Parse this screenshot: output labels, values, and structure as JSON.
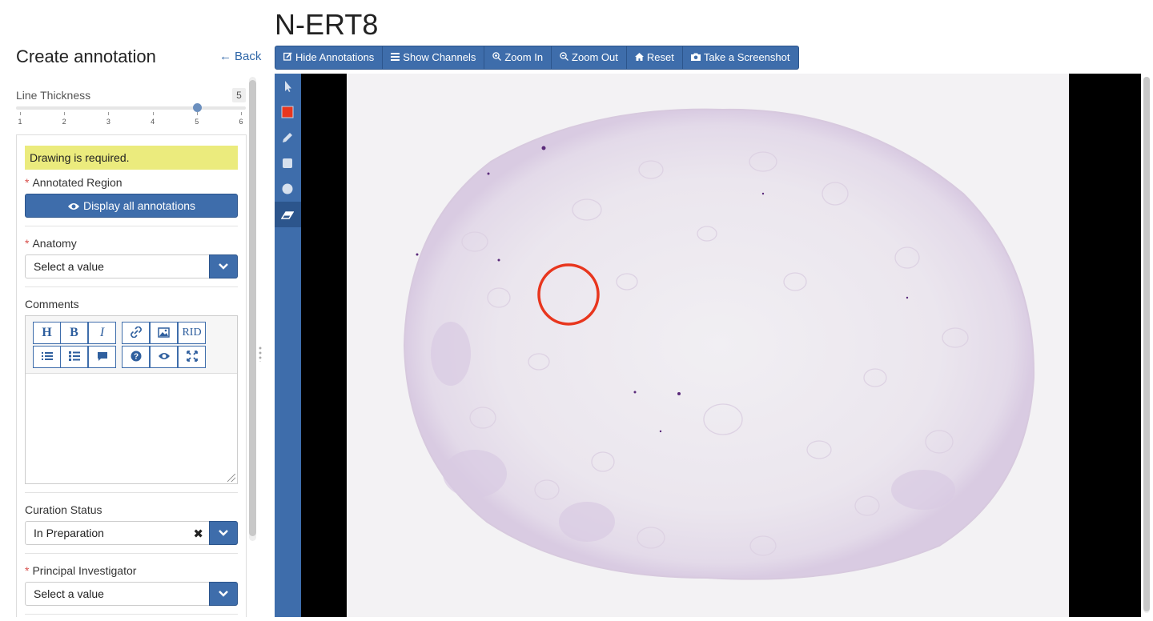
{
  "panel": {
    "title": "Create annotation",
    "back_label": "Back",
    "line_thickness_label": "Line Thickness",
    "line_thickness_value": "5",
    "slider_ticks": [
      "1",
      "2",
      "3",
      "4",
      "5",
      "6"
    ],
    "slider_level": 5
  },
  "form": {
    "notice": "Drawing is required.",
    "annotated_region_label": "Annotated Region",
    "display_all_label": "Display all annotations",
    "anatomy_label": "Anatomy",
    "anatomy_value": "Select a value",
    "comments_label": "Comments",
    "editor_buttons_row1": [
      "H",
      "B",
      "I",
      "link-icon",
      "image-icon",
      "RID"
    ],
    "editor_buttons_row2": [
      "list-ul-icon",
      "list-bullets-icon",
      "comment-icon",
      "question-icon",
      "eye-icon",
      "fullscreen-icon"
    ],
    "editor_rid_label": "RID",
    "curation_status_label": "Curation Status",
    "curation_status_value": "In Preparation",
    "pi_label": "Principal Investigator",
    "pi_value": "Select a value"
  },
  "viewer": {
    "title": "N-ERT8",
    "toolbar": [
      {
        "label": "Hide Annotations",
        "icon": "edit-icon"
      },
      {
        "label": "Show Channels",
        "icon": "list-icon"
      },
      {
        "label": "Zoom In",
        "icon": "zoom-in-icon"
      },
      {
        "label": "Zoom Out",
        "icon": "zoom-out-icon"
      },
      {
        "label": "Reset",
        "icon": "home-icon"
      },
      {
        "label": "Take a Screenshot",
        "icon": "camera-icon"
      }
    ],
    "tools": [
      "cursor-icon",
      "color-swatch-icon",
      "pencil-icon",
      "rectangle-icon",
      "circle-icon",
      "eraser-icon"
    ],
    "annotation_color": "#e8361e",
    "accent_color": "#3e6dab"
  }
}
